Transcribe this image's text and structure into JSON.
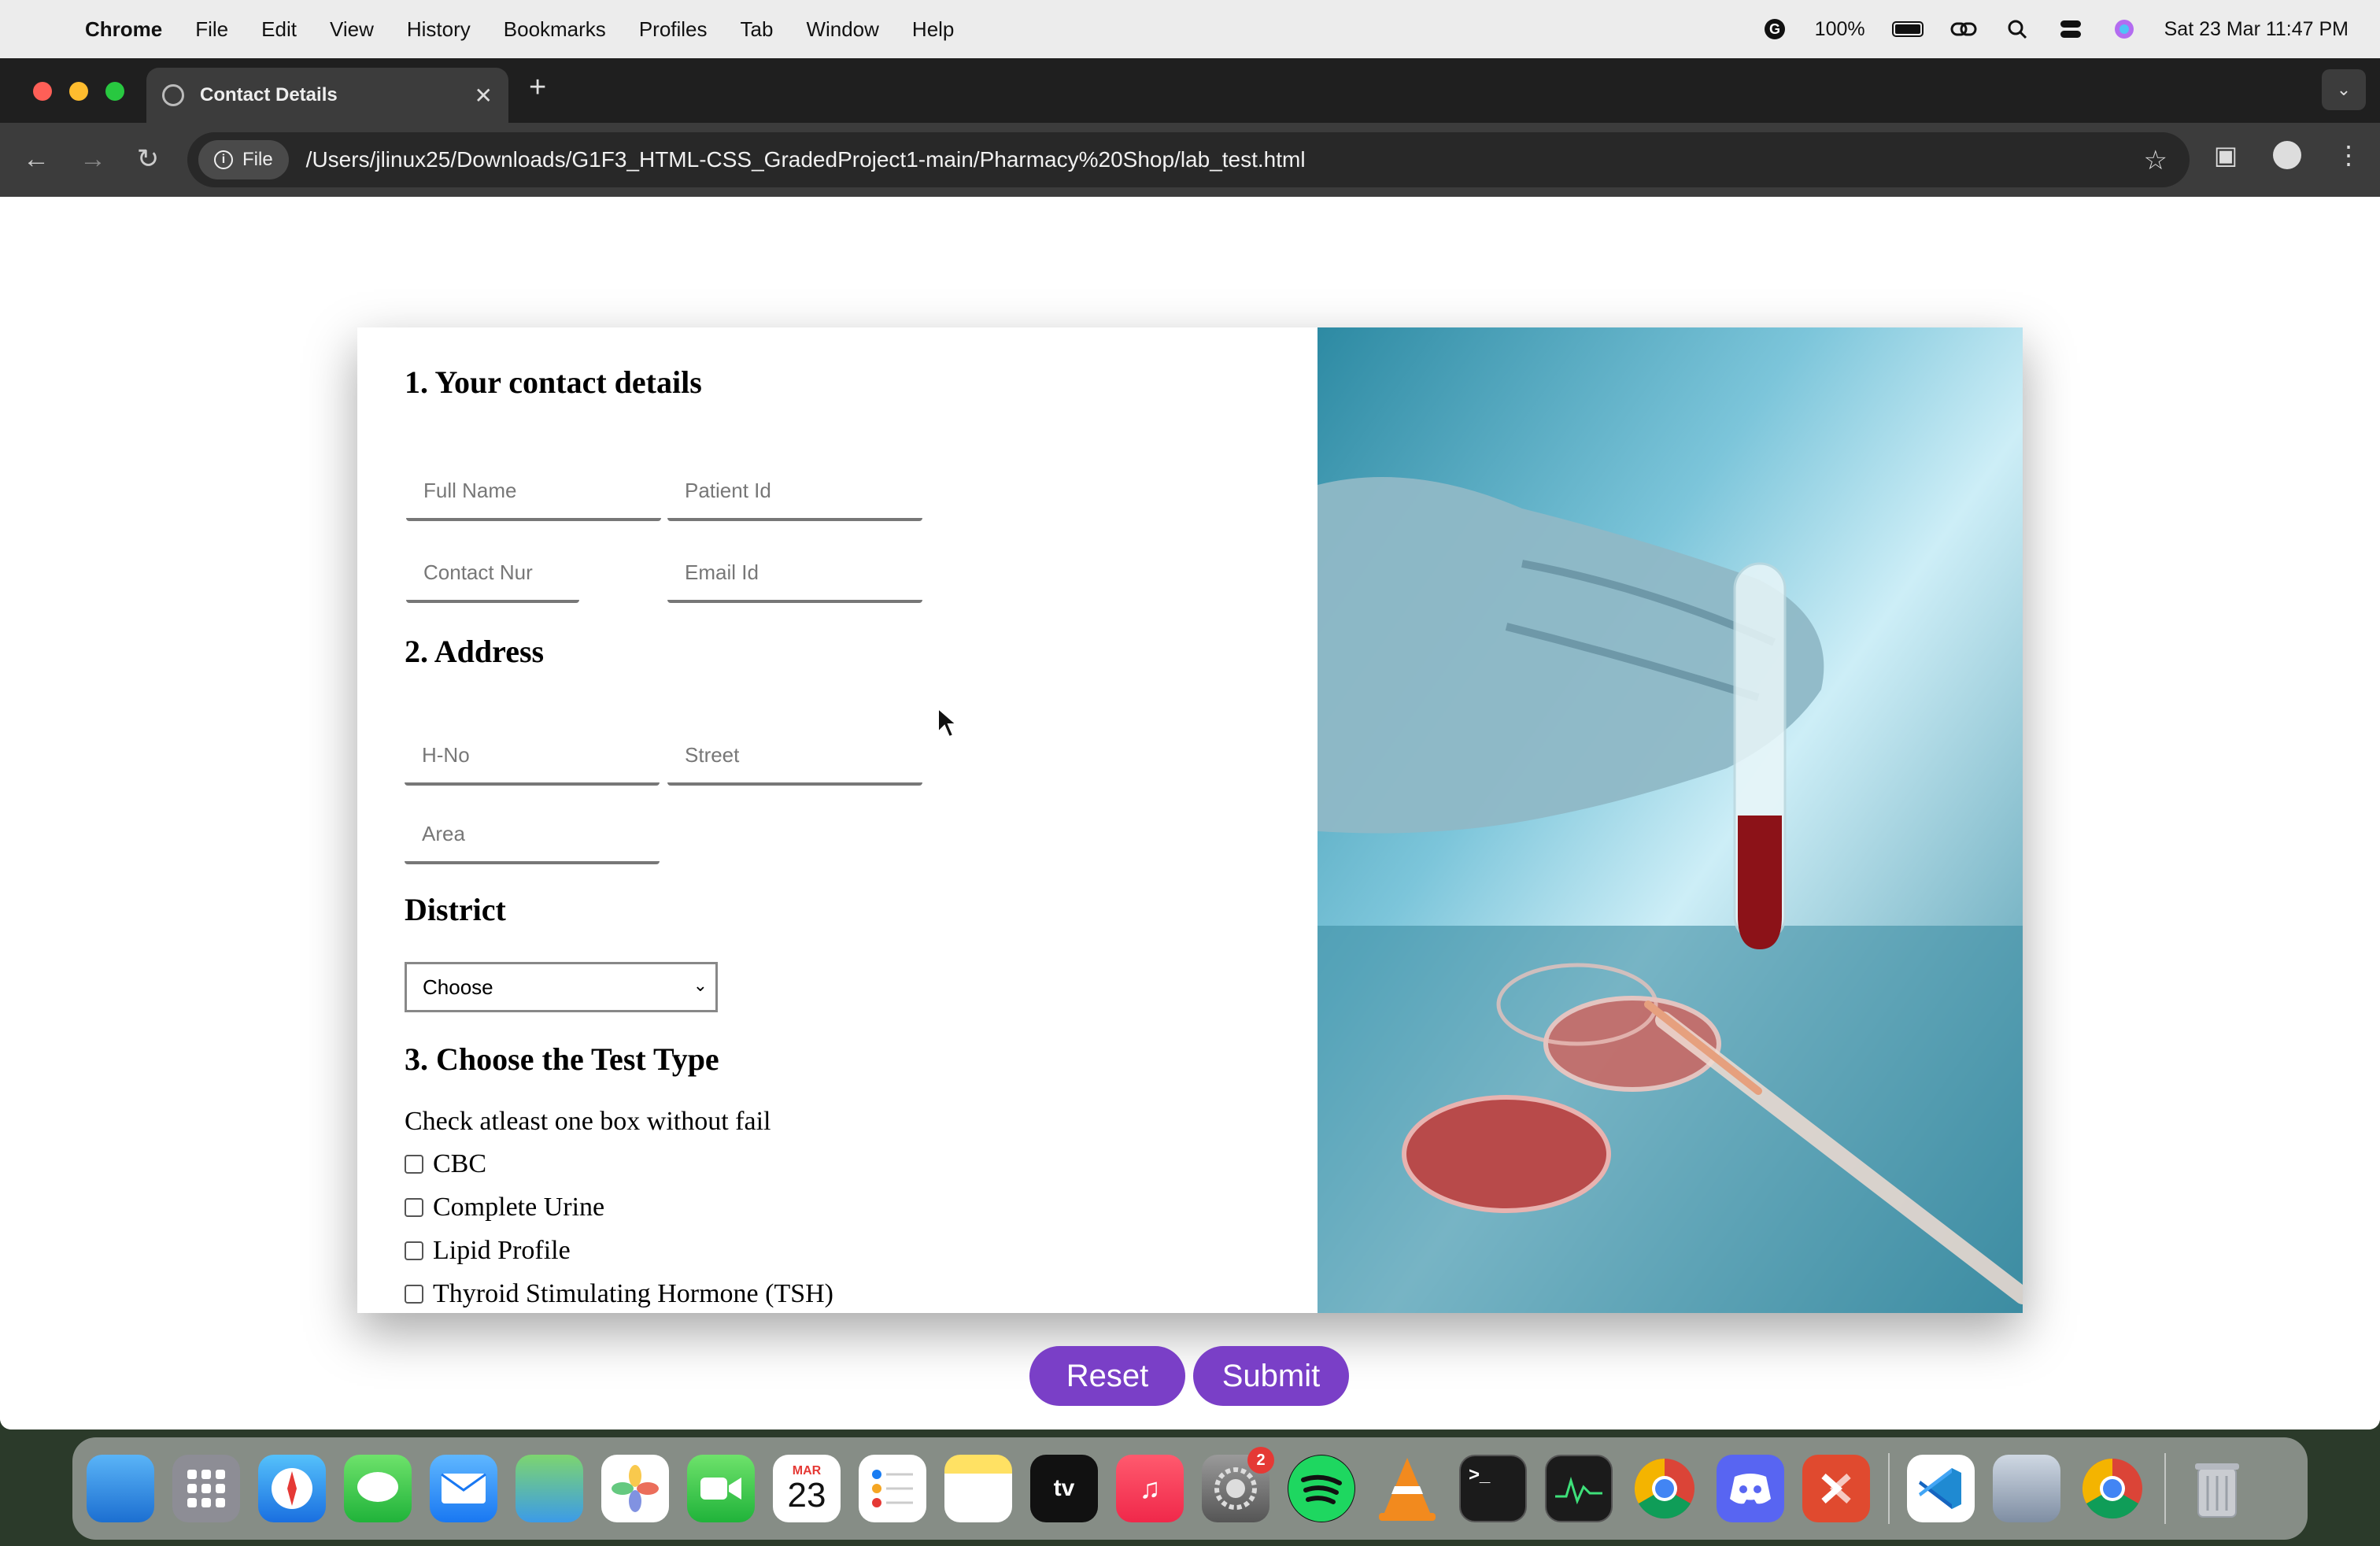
{
  "menubar": {
    "app_name": "Chrome",
    "items": [
      "File",
      "Edit",
      "View",
      "History",
      "Bookmarks",
      "Profiles",
      "Tab",
      "Window",
      "Help"
    ],
    "battery": "100%",
    "datetime": "Sat 23 Mar  11:47 PM"
  },
  "browser": {
    "tab_title": "Contact Details",
    "url_chip": "File",
    "url": "/Users/jlinux25/Downloads/G1F3_HTML-CSS_GradedProject1-main/Pharmacy%20Shop/lab_test.html"
  },
  "form": {
    "section1_title": "1. Your contact details",
    "full_name_placeholder": "Full Name",
    "patient_id_placeholder": "Patient Id",
    "contact_placeholder": "Contact Nur",
    "email_placeholder": "Email Id",
    "section2_title": "2. Address",
    "hno_placeholder": "H-No",
    "street_placeholder": "Street",
    "area_placeholder": "Area",
    "district_title": "District",
    "district_value": "Choose",
    "section3_title": "3. Choose the Test Type",
    "hint": "Check atleast one box without fail",
    "tests": [
      "CBC",
      "Complete Urine",
      "Lipid Profile",
      "Thyroid Stimulating Hormone (TSH)"
    ],
    "reset_label": "Reset",
    "submit_label": "Submit"
  },
  "dock": {
    "calendar_month": "MAR",
    "calendar_day": "23",
    "settings_badge": "2"
  },
  "colors": {
    "button": "#7a3fc7",
    "tab_bar": "#1f1f1f",
    "toolbar": "#3c3c3c"
  }
}
